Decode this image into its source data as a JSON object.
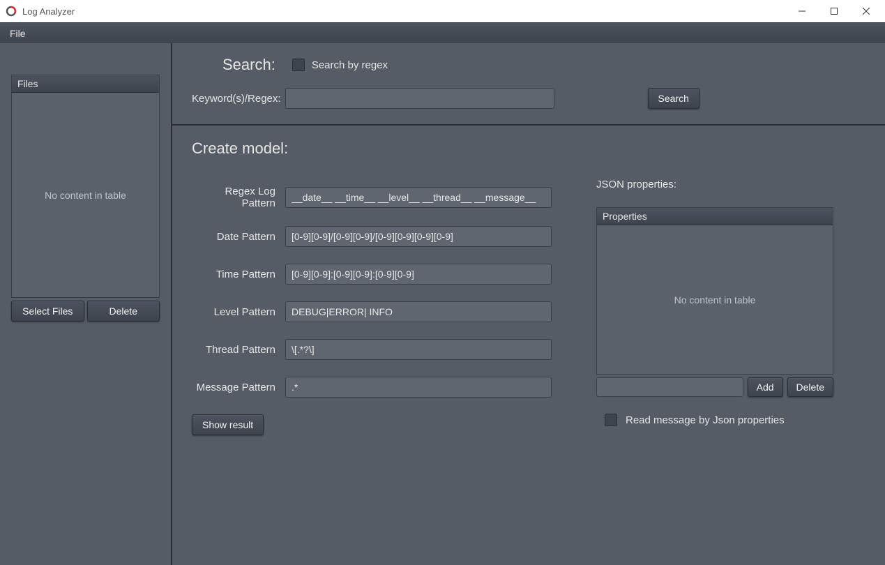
{
  "window": {
    "title": "Log Analyzer"
  },
  "menubar": {
    "file": "File"
  },
  "sidebar": {
    "files_header": "Files",
    "empty_text": "No content in table",
    "select_files_btn": "Select Files",
    "delete_btn": "Delete"
  },
  "search": {
    "heading": "Search:",
    "regex_checkbox_label": "Search by regex",
    "keywords_label": "Keyword(s)/Regex:",
    "keywords_value": "",
    "search_btn": "Search"
  },
  "model": {
    "heading": "Create model:",
    "fields": {
      "regex_log_pattern": {
        "label": "Regex Log Pattern",
        "value": "__date__ __time__ __level__ __thread__ __message__"
      },
      "date_pattern": {
        "label": "Date Pattern",
        "value": "[0-9][0-9]/[0-9][0-9]/[0-9][0-9][0-9][0-9]"
      },
      "time_pattern": {
        "label": "Time Pattern",
        "value": "[0-9][0-9]:[0-9][0-9]:[0-9][0-9]"
      },
      "level_pattern": {
        "label": "Level Pattern",
        "value": "DEBUG|ERROR| INFO"
      },
      "thread_pattern": {
        "label": "Thread Pattern",
        "value": "\\[.*?\\]"
      },
      "message_pattern": {
        "label": "Message Pattern",
        "value": ".*"
      }
    },
    "show_result_btn": "Show result"
  },
  "json_props": {
    "heading": "JSON properties:",
    "table_header": "Properties",
    "empty_text": "No content in table",
    "new_prop_value": "",
    "add_btn": "Add",
    "delete_btn": "Delete",
    "read_by_json_label": "Read message by Json properties"
  }
}
